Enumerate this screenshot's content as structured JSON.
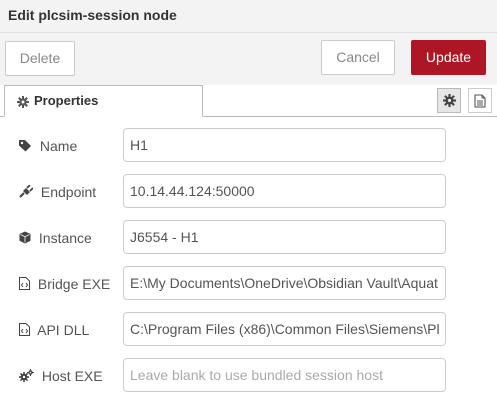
{
  "dialog": {
    "title": "Edit plcsim-session node"
  },
  "toolbar": {
    "delete_label": "Delete",
    "cancel_label": "Cancel",
    "update_label": "Update"
  },
  "tabs": [
    {
      "label": "Properties",
      "icon": "gear-icon"
    }
  ],
  "tab_actions": [
    {
      "icon": "gear-icon"
    },
    {
      "icon": "document-icon"
    }
  ],
  "form": {
    "name": {
      "label": "Name",
      "value": "H1",
      "icon": "tag-icon"
    },
    "endpoint": {
      "label": "Endpoint",
      "value": "10.14.44.124:50000",
      "icon": "plug-icon"
    },
    "instance": {
      "label": "Instance",
      "value": "J6554 - H1",
      "icon": "cube-icon"
    },
    "bridge_exe": {
      "label": "Bridge EXE",
      "value": "E:\\My Documents\\OneDrive\\Obsidian Vault\\Aquat",
      "icon": "file-code-icon"
    },
    "api_dll": {
      "label": "API DLL",
      "value": "C:\\Program Files (x86)\\Common Files\\Siemens\\Pl",
      "icon": "file-code-icon"
    },
    "host_exe": {
      "label": "Host EXE",
      "value": "",
      "placeholder": "Leave blank to use bundled session host",
      "icon": "gears-icon"
    }
  },
  "colors": {
    "primary_button": "#ad1625",
    "header_bg": "#f3f3f3"
  }
}
